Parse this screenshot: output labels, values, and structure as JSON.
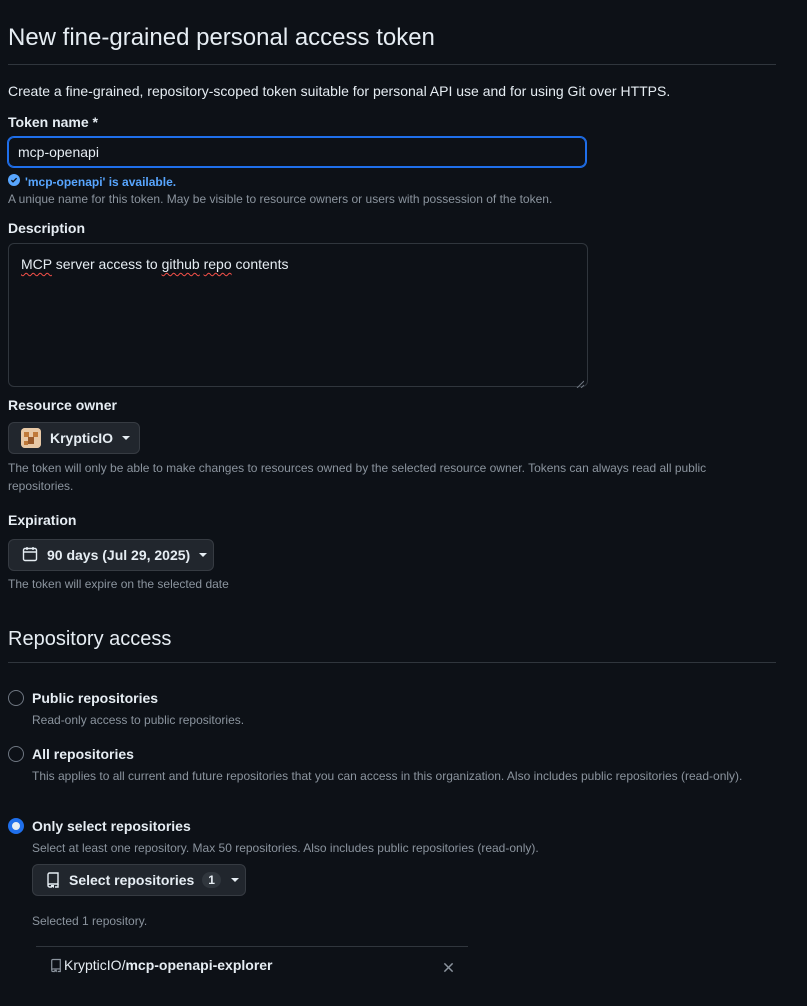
{
  "page": {
    "title": "New fine-grained personal access token",
    "lead": "Create a fine-grained, repository-scoped token suitable for personal API use and for using Git over HTTPS."
  },
  "token_name": {
    "label": "Token name *",
    "value": "mcp-openapi",
    "available": "'mcp-openapi' is available.",
    "hint": "A unique name for this token. May be visible to resource owners or users with possession of the token."
  },
  "description": {
    "label": "Description",
    "words": [
      "MCP",
      " server access to ",
      "github",
      " ",
      "repo",
      " contents"
    ]
  },
  "resource_owner": {
    "label": "Resource owner",
    "value": "KrypticIO",
    "hint": "The token will only be able to make changes to resources owned by the selected resource owner. Tokens can always read all public repositories."
  },
  "expiration": {
    "label": "Expiration",
    "value": "90 days (Jul 29, 2025)",
    "hint": "The token will expire on the selected date"
  },
  "repository_access": {
    "title": "Repository access",
    "options": [
      {
        "label": "Public repositories",
        "desc": "Read-only access to public repositories.",
        "selected": false
      },
      {
        "label": "All repositories",
        "desc": "This applies to all current and future repositories that you can access in this organization. Also includes public repositories (read-only).",
        "selected": false
      },
      {
        "label": "Only select repositories",
        "desc": "Select at least one repository. Max 50 repositories. Also includes public repositories (read-only).",
        "selected": true
      }
    ],
    "select_button": {
      "label": "Select repositories",
      "count": "1"
    },
    "selected_summary": "Selected 1 repository.",
    "selected_repo": {
      "owner": "KrypticIO/",
      "name": "mcp-openapi-explorer"
    }
  },
  "colors": {
    "accent": "#1f6feb",
    "success_text": "#58a6ff",
    "background": "#0d1117"
  },
  "icons": [
    "check-circle-icon",
    "calendar-icon",
    "repo-icon",
    "close-icon",
    "chevron-down-icon"
  ]
}
